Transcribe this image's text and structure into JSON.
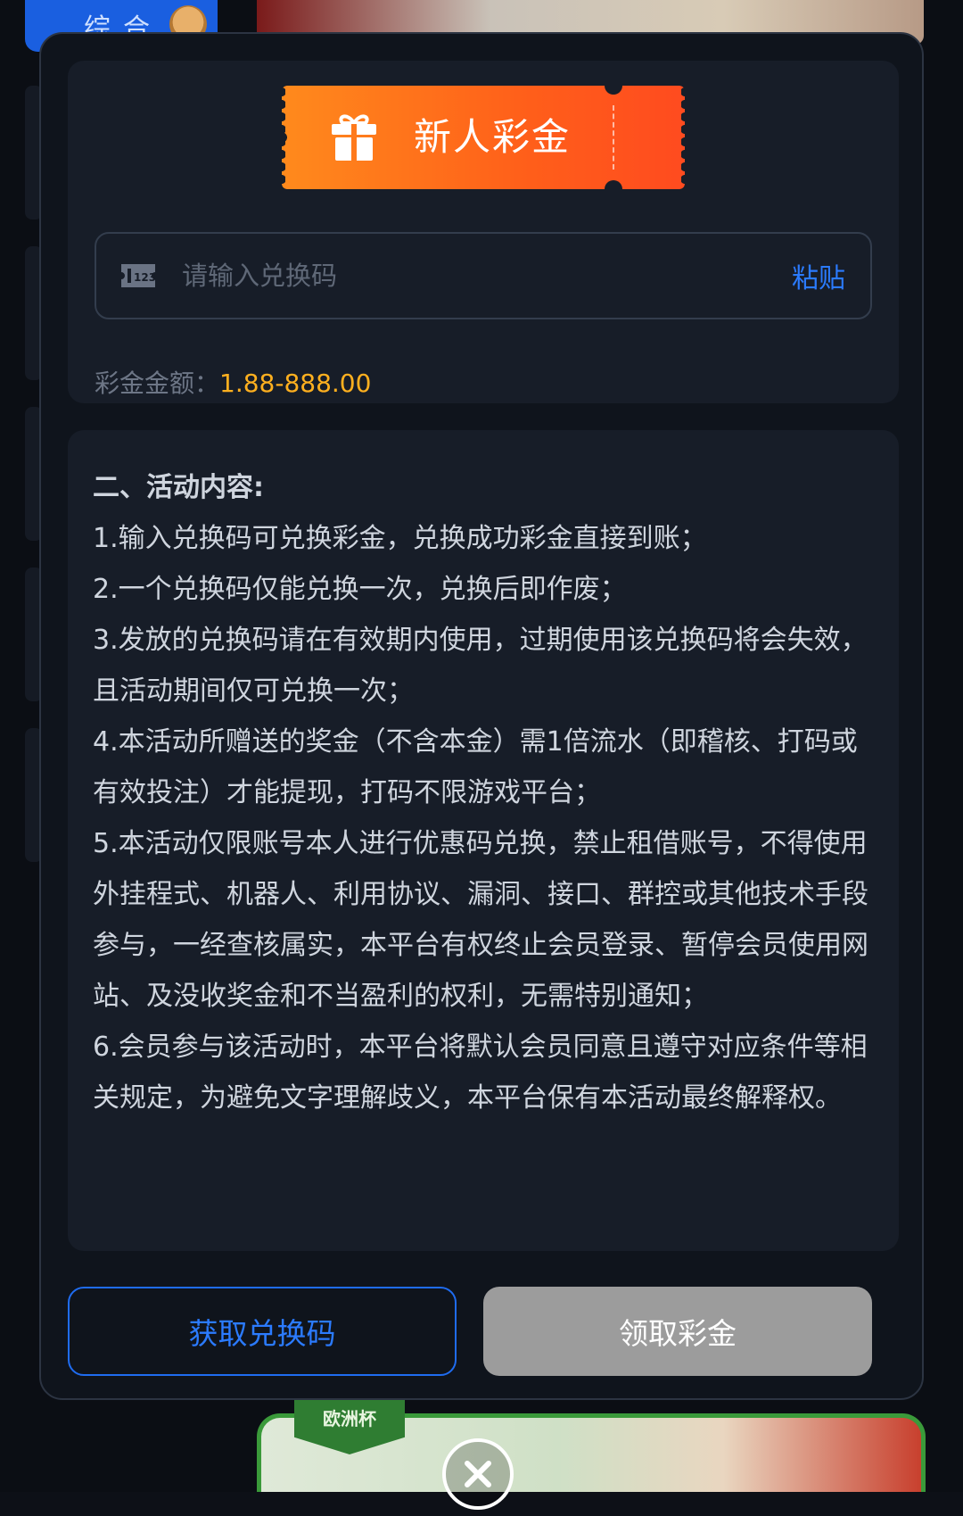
{
  "background": {
    "tab_label": "综合",
    "banner_badge": "欧洲杯"
  },
  "modal": {
    "ticket_title": "新人彩金",
    "code_input": {
      "placeholder": "请输入兑换码",
      "value": ""
    },
    "paste_label": "粘贴",
    "amount_label": "彩金金额：",
    "amount_value": "1.88-888.00",
    "rules_title": "二、活动内容:",
    "rules": [
      "1.输入兑换码可兑换彩金，兑换成功彩金直接到账；",
      "2.一个兑换码仅能兑换一次，兑换后即作废；",
      "3.发放的兑换码请在有效期内使用，过期使用该兑换码将会失效，且活动期间仅可兑换一次；",
      "4.本活动所赠送的奖金（不含本金）需1倍流水（即稽核、打码或有效投注）才能提现，打码不限游戏平台；",
      "5.本活动仅限账号本人进行优惠码兑换，禁止租借账号，不得使用外挂程式、机器人、利用协议、漏洞、接口、群控或其他技术手段参与，一经查核属实，本平台有权终止会员登录、暂停会员使用网站、及没收奖金和不当盈利的权利，无需特别通知；",
      "6.会员参与该活动时，本平台将默认会员同意且遵守对应条件等相关规定，为避免文字理解歧义，本平台保有本活动最终解释权。"
    ],
    "get_code_button": "获取兑换码",
    "claim_button": "领取彩金"
  },
  "colors": {
    "accent_blue": "#2b7bff",
    "amount_orange": "#ffb01f",
    "ticket_orange": "#ff6a1c",
    "disabled_gray": "#9c9c9c"
  },
  "icons": {
    "gift": "gift-icon",
    "code": "code-123-icon",
    "close": "close-icon"
  }
}
